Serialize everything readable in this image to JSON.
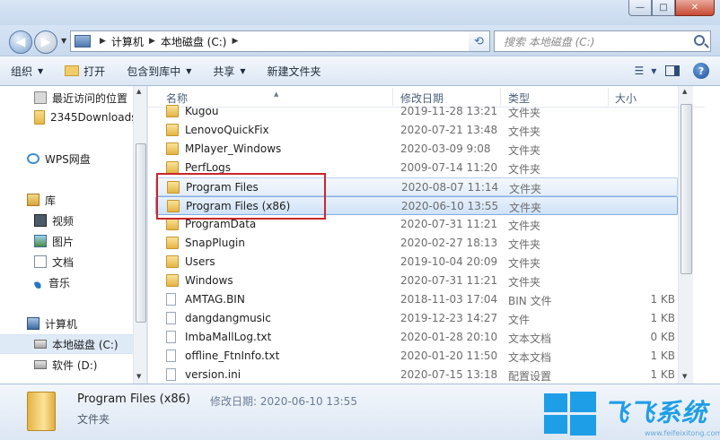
{
  "window": {
    "minimize_glyph": "—",
    "maximize_glyph": "□",
    "close_glyph": "✕"
  },
  "address": {
    "back_glyph": "◀",
    "forward_glyph": "▶",
    "crumbs": [
      "计算机",
      "本地磁盘 (C:)"
    ],
    "search_placeholder": "搜索 本地磁盘 (C:)"
  },
  "toolbar": {
    "organize": "组织",
    "open": "打开",
    "include_in_library": "包含到库中",
    "share": "共享",
    "new_folder": "新建文件夹"
  },
  "nav_pane": {
    "items": [
      {
        "label": "最近访问的位置",
        "icon": "recent-icon"
      },
      {
        "label": "2345Downloads",
        "icon": "folder-icon"
      },
      {
        "label": "WPS网盘",
        "icon": "cloud-icon"
      },
      {
        "label": "库",
        "icon": "library-icon"
      },
      {
        "label": "视频",
        "icon": "video-icon"
      },
      {
        "label": "图片",
        "icon": "picture-icon"
      },
      {
        "label": "文档",
        "icon": "document-icon"
      },
      {
        "label": "音乐",
        "icon": "music-icon"
      },
      {
        "label": "计算机",
        "icon": "computer-icon"
      },
      {
        "label": "本地磁盘 (C:)",
        "icon": "drive-icon",
        "selected": true
      },
      {
        "label": "软件 (D:)",
        "icon": "drive-icon"
      }
    ]
  },
  "columns": {
    "name": "名称",
    "date": "修改日期",
    "type": "类型",
    "size": "大小"
  },
  "files": [
    {
      "name": "Kugou",
      "date": "2019-11-28 13:21",
      "type": "文件夹",
      "size": "",
      "kind": "folder"
    },
    {
      "name": "LenovoQuickFix",
      "date": "2020-07-21 13:48",
      "type": "文件夹",
      "size": "",
      "kind": "folder"
    },
    {
      "name": "MPlayer_Windows",
      "date": "2020-03-09 9:08",
      "type": "文件夹",
      "size": "",
      "kind": "folder"
    },
    {
      "name": "PerfLogs",
      "date": "2009-07-14 11:20",
      "type": "文件夹",
      "size": "",
      "kind": "folder"
    },
    {
      "name": "Program Files",
      "date": "2020-08-07 11:14",
      "type": "文件夹",
      "size": "",
      "kind": "folder",
      "state": "hover"
    },
    {
      "name": "Program Files (x86)",
      "date": "2020-06-10 13:55",
      "type": "文件夹",
      "size": "",
      "kind": "folder",
      "state": "selected"
    },
    {
      "name": "ProgramData",
      "date": "2020-07-31 11:21",
      "type": "文件夹",
      "size": "",
      "kind": "folder"
    },
    {
      "name": "SnapPlugin",
      "date": "2020-02-27 18:13",
      "type": "文件夹",
      "size": "",
      "kind": "folder"
    },
    {
      "name": "Users",
      "date": "2019-10-04 20:09",
      "type": "文件夹",
      "size": "",
      "kind": "folder"
    },
    {
      "name": "Windows",
      "date": "2020-07-31 11:21",
      "type": "文件夹",
      "size": "",
      "kind": "folder"
    },
    {
      "name": "AMTAG.BIN",
      "date": "2018-11-03 17:04",
      "type": "BIN 文件",
      "size": "1 KB",
      "kind": "file"
    },
    {
      "name": "dangdangmusic",
      "date": "2019-12-23 14:27",
      "type": "文件",
      "size": "1 KB",
      "kind": "file"
    },
    {
      "name": "ImbaMallLog.txt",
      "date": "2020-01-28 20:10",
      "type": "文本文档",
      "size": "0 KB",
      "kind": "file"
    },
    {
      "name": "offline_FtnInfo.txt",
      "date": "2020-01-20 11:50",
      "type": "文本文档",
      "size": "1 KB",
      "kind": "file"
    },
    {
      "name": "version.ini",
      "date": "2020-07-15 13:18",
      "type": "配置设置",
      "size": "1 KB",
      "kind": "file"
    }
  ],
  "details": {
    "name": "Program Files (x86)",
    "modified_label": "修改日期: 2020-06-10 13:55",
    "type": "文件夹"
  },
  "watermark": {
    "text": "飞飞系统",
    "url": "www.feifeixitong.com"
  },
  "colors": {
    "accent": "#1f9ee8",
    "highlight_box": "#c8262c",
    "selection": "#cfe2f7"
  }
}
